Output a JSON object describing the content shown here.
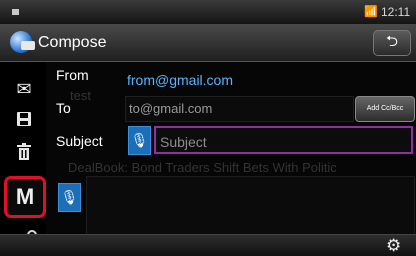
{
  "status": {
    "time": "12:11",
    "wifi_icon": "wifi-icon"
  },
  "header": {
    "title": "Compose",
    "back_icon": "back-arrow-icon"
  },
  "sidebar": [
    {
      "name": "mail-icon",
      "glyph": "✉"
    },
    {
      "name": "save-icon",
      "glyph": "💾"
    },
    {
      "name": "trash-icon",
      "glyph": "🗑"
    },
    {
      "name": "gmail-icon",
      "glyph": "M"
    },
    {
      "name": "search-icon",
      "glyph": "🔍"
    }
  ],
  "form": {
    "from_label": "From",
    "from_value": "from@gmail.com",
    "to_label": "To",
    "to_placeholder": "to@gmail.com",
    "add_cc_label": "Add Cc/Bcc",
    "subject_label": "Subject",
    "subject_placeholder": "Subject",
    "ghost_to": "test",
    "ghost_body": "DealBook: Bond Traders Shift Bets With Politic"
  },
  "bottom": {
    "gear_icon": "gear-icon"
  }
}
